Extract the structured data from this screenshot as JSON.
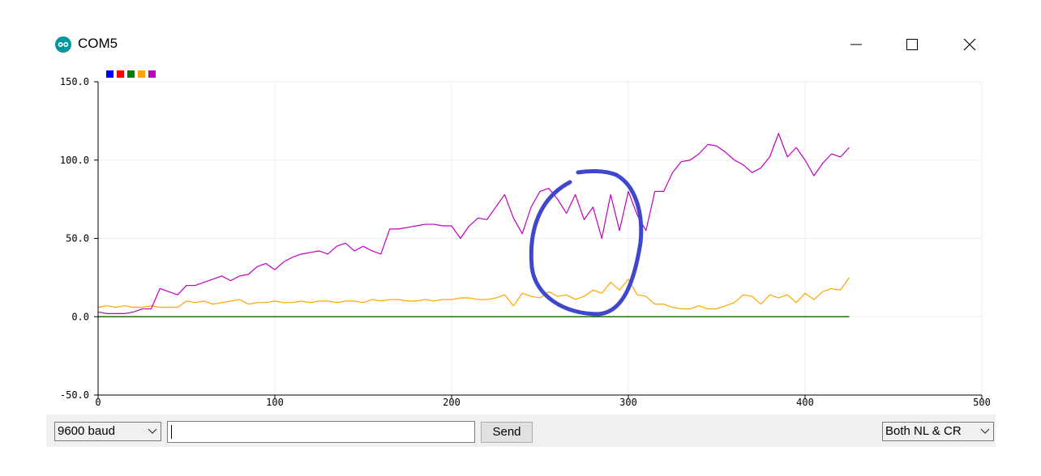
{
  "window": {
    "title": "COM5",
    "icon": "arduino-icon",
    "controls": [
      "minimize-icon",
      "maximize-icon",
      "close-icon"
    ]
  },
  "chart_data": {
    "type": "line",
    "title": "",
    "xlabel": "",
    "ylabel": "",
    "xlim": [
      0,
      500
    ],
    "ylim": [
      -50,
      150
    ],
    "x_ticks": [
      "0",
      "100",
      "200",
      "300",
      "400",
      "500"
    ],
    "y_ticks": [
      "150.0",
      "100.0",
      "50.0",
      "0.0",
      "-50.0"
    ],
    "grid": true,
    "legend_placement": "top-left",
    "x_step": 5,
    "series": [
      {
        "color": "#0000ff",
        "values": [
          0,
          0,
          0,
          0,
          0,
          0,
          0,
          0,
          0,
          0,
          0,
          0,
          0,
          0,
          0,
          0,
          0,
          0,
          0,
          0,
          0,
          0,
          0,
          0,
          0,
          0,
          0,
          0,
          0,
          0,
          0,
          0,
          0,
          0,
          0,
          0,
          0,
          0,
          0,
          0,
          0,
          0,
          0,
          0,
          0,
          0,
          0,
          0,
          0,
          0,
          0,
          0,
          0,
          0,
          0,
          0,
          0,
          0,
          0,
          0,
          0,
          0,
          0,
          0,
          0,
          0,
          0,
          0,
          0,
          0,
          0,
          0,
          0,
          0,
          0,
          0,
          0,
          0,
          0,
          0,
          0,
          0,
          0,
          0,
          0,
          0
        ]
      },
      {
        "color": "#ff0000",
        "values": [
          0,
          0,
          0,
          0,
          0,
          0,
          0,
          0,
          0,
          0,
          0,
          0,
          0,
          0,
          0,
          0,
          0,
          0,
          0,
          0,
          0,
          0,
          0,
          0,
          0,
          0,
          0,
          0,
          0,
          0,
          0,
          0,
          0,
          0,
          0,
          0,
          0,
          0,
          0,
          0,
          0,
          0,
          0,
          0,
          0,
          0,
          0,
          0,
          0,
          0,
          0,
          0,
          0,
          0,
          0,
          0,
          0,
          0,
          0,
          0,
          0,
          0,
          0,
          0,
          0,
          0,
          0,
          0,
          0,
          0,
          0,
          0,
          0,
          0,
          0,
          0,
          0,
          0,
          0,
          0,
          0,
          0,
          0,
          0,
          0,
          0
        ]
      },
      {
        "color": "#008000",
        "values": [
          0,
          0,
          0,
          0,
          0,
          0,
          0,
          0,
          0,
          0,
          0,
          0,
          0,
          0,
          0,
          0,
          0,
          0,
          0,
          0,
          0,
          0,
          0,
          0,
          0,
          0,
          0,
          0,
          0,
          0,
          0,
          0,
          0,
          0,
          0,
          0,
          0,
          0,
          0,
          0,
          0,
          0,
          0,
          0,
          0,
          0,
          0,
          0,
          0,
          0,
          0,
          0,
          0,
          0,
          0,
          0,
          0,
          0,
          0,
          0,
          0,
          0,
          0,
          0,
          0,
          0,
          0,
          0,
          0,
          0,
          0,
          0,
          0,
          0,
          0,
          0,
          0,
          0,
          0,
          0,
          0,
          0,
          0,
          0,
          0,
          0
        ]
      },
      {
        "color": "#ffa500",
        "values": [
          6,
          7,
          6,
          7,
          6,
          6,
          7,
          6,
          6,
          6,
          10,
          9,
          10,
          8,
          9,
          10,
          11,
          8,
          9,
          9,
          10,
          9,
          9,
          10,
          9,
          10,
          10,
          9,
          10,
          10,
          9,
          11,
          10,
          11,
          11,
          10,
          10,
          11,
          10,
          11,
          11,
          12,
          12,
          11,
          11,
          12,
          14,
          7,
          15,
          13,
          12,
          16,
          13,
          14,
          11,
          13,
          17,
          15,
          22,
          17,
          24,
          14,
          13,
          8,
          8,
          6,
          5,
          5,
          7,
          5,
          5,
          7,
          9,
          14,
          13,
          8,
          14,
          12,
          14,
          9,
          15,
          11,
          16,
          18,
          17,
          25
        ]
      },
      {
        "color": "#c000c0",
        "values": [
          3,
          2,
          2,
          2,
          3,
          5,
          5,
          18,
          16,
          14,
          20,
          20,
          22,
          24,
          26,
          23,
          26,
          27,
          32,
          34,
          30,
          35,
          38,
          40,
          41,
          42,
          40,
          45,
          47,
          42,
          45,
          42,
          40,
          56,
          56,
          57,
          58,
          59,
          59,
          58,
          58,
          50,
          58,
          63,
          62,
          70,
          78,
          63,
          53,
          70,
          80,
          82,
          75,
          66,
          78,
          62,
          70,
          50,
          78,
          55,
          80,
          65,
          55,
          80,
          80,
          92,
          99,
          100,
          104,
          110,
          109,
          105,
          100,
          97,
          92,
          95,
          102,
          117,
          102,
          108,
          100,
          90,
          98,
          104,
          102,
          108
        ]
      }
    ]
  },
  "controls": {
    "baud_rate": "9600 baud",
    "message_value": "",
    "send_label": "Send",
    "line_ending": "Both NL & CR"
  },
  "colors": {
    "annotation_circle": "#3f48cc",
    "grid": "#eeeeee"
  }
}
